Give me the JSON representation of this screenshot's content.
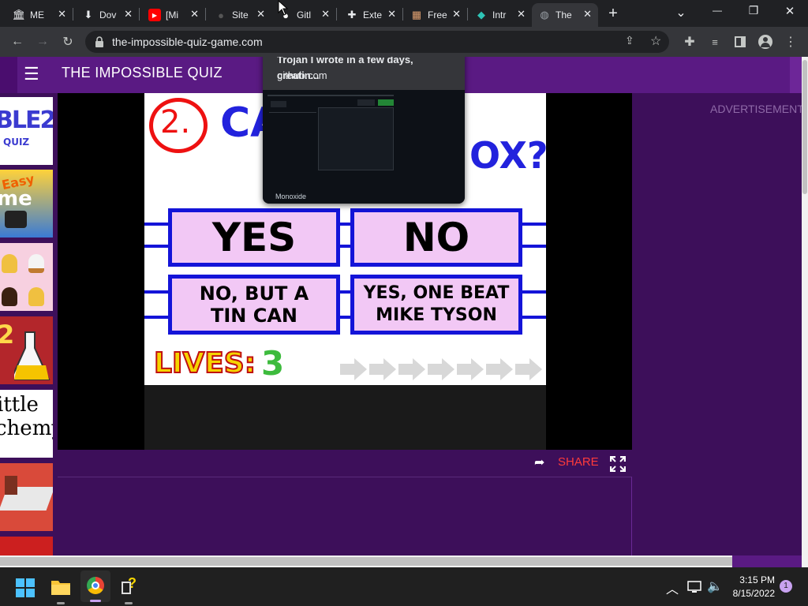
{
  "browser": {
    "tabs": [
      {
        "icon": "bank-icon",
        "glyph": "🏛",
        "title": "ME"
      },
      {
        "icon": "download-icon",
        "glyph": "⬇",
        "title": "Dov"
      },
      {
        "icon": "youtube-icon",
        "glyph": "▶",
        "title": "[Mi"
      },
      {
        "icon": "github-icon",
        "glyph": "●",
        "title": "Site"
      },
      {
        "icon": "github-icon",
        "glyph": "●",
        "title": "Gitl"
      },
      {
        "icon": "puzzle-icon",
        "glyph": "✚",
        "title": "Exte"
      },
      {
        "icon": "store-icon",
        "glyph": "▦",
        "title": "Free"
      },
      {
        "icon": "shield-icon",
        "glyph": "◆",
        "title": "Intr"
      },
      {
        "icon": "globe-icon",
        "glyph": "◍",
        "title": "The"
      }
    ],
    "url": "the-impossible-quiz-game.com",
    "new_tab": "+",
    "window_controls": {
      "minimize": "—",
      "restore": "❐",
      "close": "✕",
      "tab_search": "⌄"
    }
  },
  "tooltip": {
    "title": "GitHub - whypet/Monoxide: A little Trojan I wrote in a few days, creatin...",
    "domain": "github.com",
    "preview_label": "Monoxide"
  },
  "site": {
    "menu_icon": "☰",
    "title": "THE IMPOSSIBLE QUIZ",
    "advertisement": "ADVERTISEMENT",
    "share_label": "SHARE"
  },
  "sidebar_games": [
    {
      "label": "BLE 2 QUIZ",
      "bg": "#ffffff",
      "fg": "#3b3bd0"
    },
    {
      "label": "Easy me",
      "bg": "#3a7bd5",
      "fg": "#f5d400"
    },
    {
      "label": "cupcakes",
      "bg": "#f7d0e0",
      "fg": "#c07a30"
    },
    {
      "label": "2",
      "bg": "#b3262b",
      "fg": "#ffd84a"
    },
    {
      "label": "ittle chemy",
      "bg": "#ffffff",
      "fg": "#000000"
    },
    {
      "label": "cube",
      "bg": "#d94a3a",
      "fg": "#ffffff"
    },
    {
      "label": "",
      "bg": "#cc1f1f",
      "fg": "#ffffff"
    }
  ],
  "game": {
    "question_number": "2.",
    "question_text_left": "CA",
    "question_text_right": "OX?",
    "answers": [
      "YES",
      "NO",
      "NO, BUT A TIN CAN",
      "YES, ONE BEAT MIKE TYSON"
    ],
    "lives_label": "LIVES:",
    "lives_value": "3",
    "skips": 7
  },
  "taskbar": {
    "time": "3:15 PM",
    "date": "8/15/2022",
    "notification_count": "1",
    "apps": [
      {
        "name": "start-icon",
        "glyph": "⊞"
      },
      {
        "name": "file-explorer-icon",
        "glyph": "▬"
      },
      {
        "name": "chrome-icon",
        "glyph": "◉"
      },
      {
        "name": "unknown-app-icon",
        "glyph": "?"
      }
    ]
  },
  "colors": {
    "site_purple": "#5a1a83",
    "page_purple": "#3d0f5a",
    "answer_fill": "#f2c8f5",
    "answer_border": "#1414d8",
    "share_red": "#ff3b3b",
    "lives_yellow": "#f5d400",
    "lives_green": "#3dbb3d"
  }
}
